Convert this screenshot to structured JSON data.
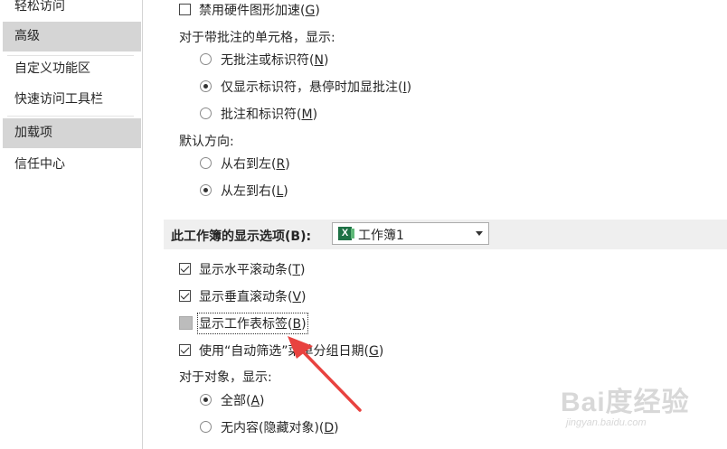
{
  "sidebar": {
    "items": [
      {
        "label": "轻松访问",
        "selected": false
      },
      {
        "label": "高级",
        "selected": true
      },
      {
        "label": "自定义功能区",
        "selected": false
      },
      {
        "label": "快速访问工具栏",
        "selected": false
      },
      {
        "label": "加载项",
        "selected": true
      },
      {
        "label": "信任中心",
        "selected": false
      }
    ]
  },
  "options": {
    "disable_hw_accel": {
      "label": "禁用硬件图形加速(",
      "key": "G",
      "suffix": ")",
      "checked": false
    },
    "comments_heading": "对于带批注的单元格，显示:",
    "comments": [
      {
        "label": "无批注或标识符(",
        "key": "N",
        "suffix": ")",
        "selected": false
      },
      {
        "label": "仅显示标识符，悬停时加显批注(",
        "key": "I",
        "suffix": ")",
        "selected": true
      },
      {
        "label": "批注和标识符(",
        "key": "M",
        "suffix": ")",
        "selected": false
      }
    ],
    "direction_heading": "默认方向:",
    "direction": [
      {
        "label": "从右到左(",
        "key": "R",
        "suffix": ")",
        "selected": false
      },
      {
        "label": "从左到右(",
        "key": "L",
        "suffix": ")",
        "selected": true
      }
    ],
    "workbook_section": {
      "title": "此工作簿的显示选项(B):",
      "dropdown_value": "工作簿1",
      "dropdown_icon": "excel-icon"
    },
    "workbook_checks": [
      {
        "label": "显示水平滚动条(",
        "key": "T",
        "suffix": ")",
        "checked": true
      },
      {
        "label": "显示垂直滚动条(",
        "key": "V",
        "suffix": ")",
        "checked": true
      },
      {
        "label": "显示工作表标签(",
        "key": "B",
        "suffix": ")",
        "checked": false
      },
      {
        "label": "使用“自动筛选”菜单分组日期(",
        "key": "G",
        "suffix": ")",
        "checked": true
      }
    ],
    "objects_heading": "对于对象，显示:",
    "objects": [
      {
        "label": "全部(",
        "key": "A",
        "suffix": ")",
        "selected": true
      },
      {
        "label": "无内容(隐藏对象)(",
        "key": "D",
        "suffix": ")",
        "selected": false
      }
    ]
  },
  "watermark": {
    "main": "Bai度经验",
    "sub": "jingyan.baidu.com"
  },
  "colors": {
    "arrow": "#e8423f",
    "excel_green": "#1e7145",
    "selected_bg": "#d5d5d5"
  }
}
